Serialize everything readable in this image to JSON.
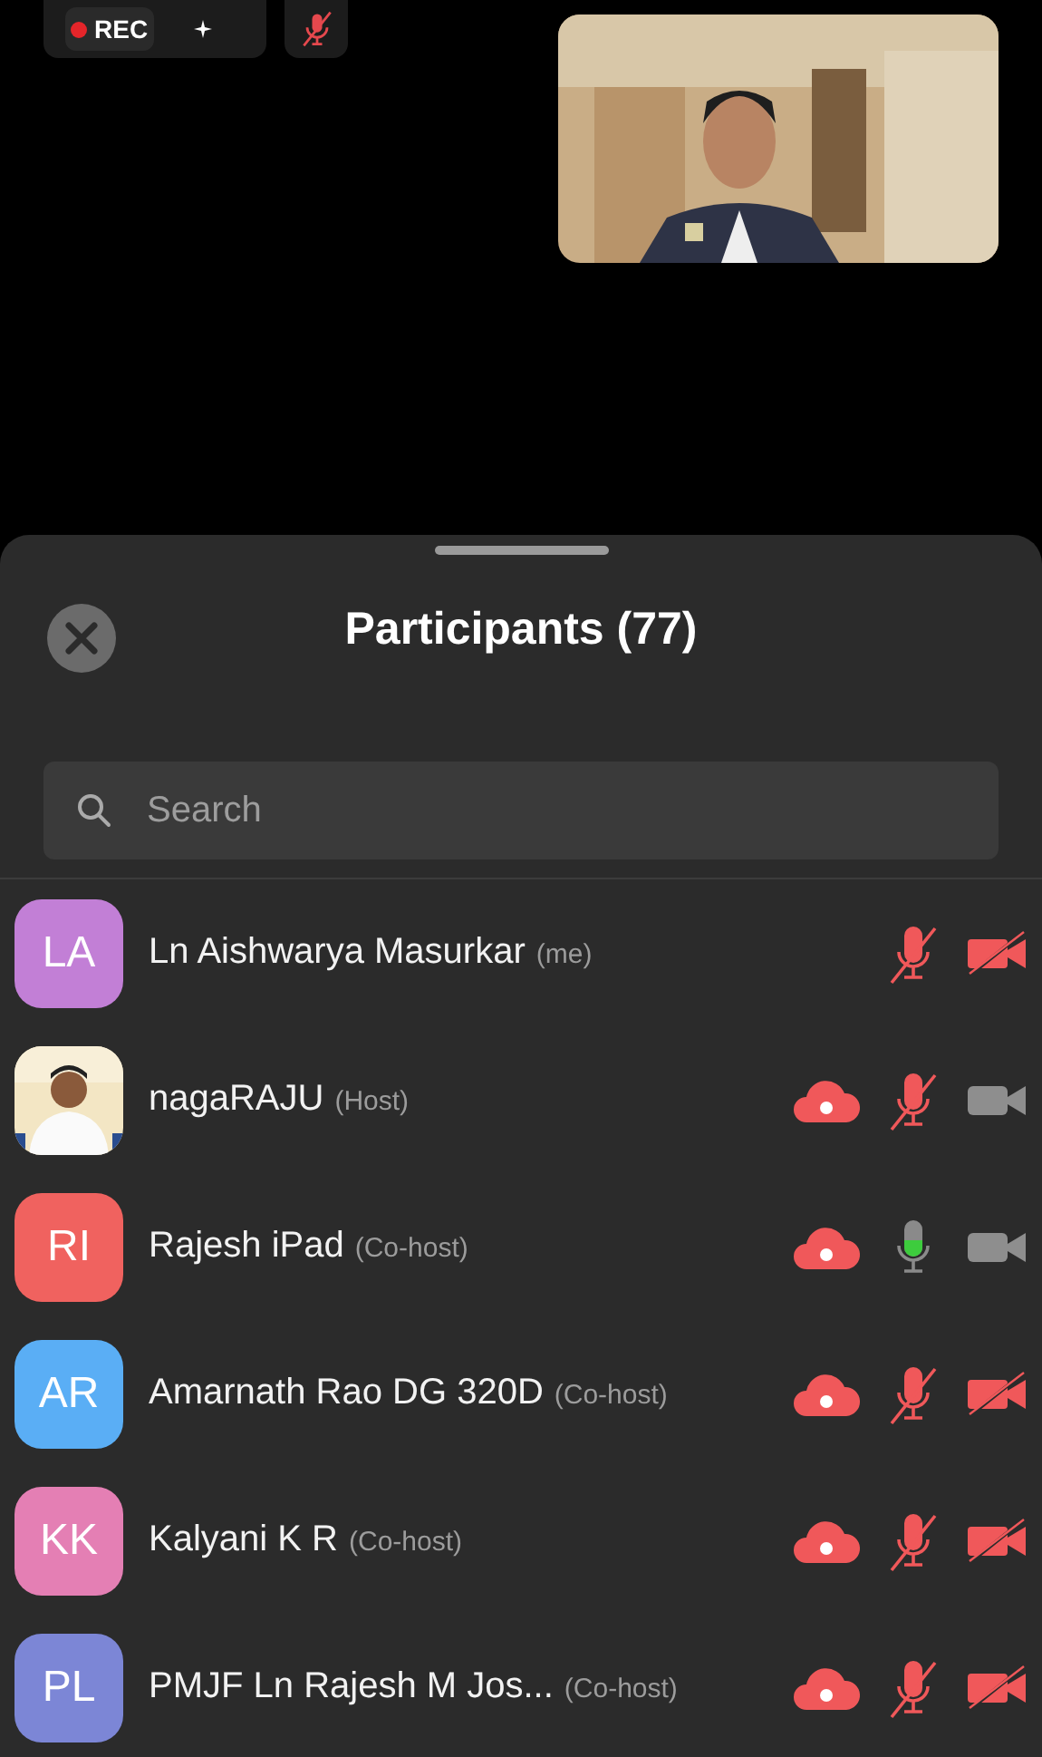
{
  "toolbar": {
    "recording_label": "REC",
    "recording": true,
    "mic_muted": true
  },
  "panel": {
    "title": "Participants (77)",
    "search": {
      "placeholder": "Search"
    }
  },
  "participants": [
    {
      "kind": "initials",
      "initials": "LA",
      "color": "#c27fd6",
      "name": "Ln Aishwarya Masurkar",
      "role": "(me)",
      "cloud": false,
      "muted": true,
      "video_off": true
    },
    {
      "kind": "picture",
      "name": "nagaRAJU",
      "role": "(Host)",
      "cloud": true,
      "muted": true,
      "video_off": false
    },
    {
      "kind": "initials",
      "initials": "RI",
      "color": "#f0625f",
      "name": "Rajesh iPad",
      "role": "(Co-host)",
      "cloud": true,
      "muted": false,
      "video_off": false
    },
    {
      "kind": "initials",
      "initials": "AR",
      "color": "#5aaef5",
      "name": "Amarnath Rao DG 320D",
      "role": "(Co-host)",
      "cloud": true,
      "muted": true,
      "video_off": true
    },
    {
      "kind": "initials",
      "initials": "KK",
      "color": "#e47fb4",
      "name": "Kalyani K R",
      "role": "(Co-host)",
      "cloud": true,
      "muted": true,
      "video_off": true
    },
    {
      "kind": "initials",
      "initials": "PL",
      "color": "#7c86d6",
      "name": "PMJF Ln Rajesh M Jos...",
      "role": "(Co-host)",
      "cloud": true,
      "muted": true,
      "video_off": true
    }
  ]
}
